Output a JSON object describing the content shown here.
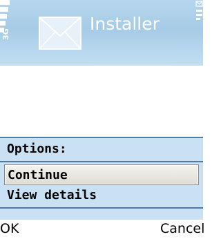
{
  "window": {
    "title": "Installer",
    "icon": "envelope-icon",
    "status_text": "3G"
  },
  "dialog": {
    "heading": "Options:",
    "options": [
      {
        "label": "Continue",
        "selected": true
      },
      {
        "label": "View details",
        "selected": false
      }
    ]
  },
  "softkeys": {
    "left": "OK",
    "right": "Cancel"
  },
  "colors": {
    "title_bar": "#a6cbe6",
    "dialog_bg": "#c9e1f3",
    "dialog_border": "#4d7da4",
    "selection_bg": "#e8e7e0"
  }
}
